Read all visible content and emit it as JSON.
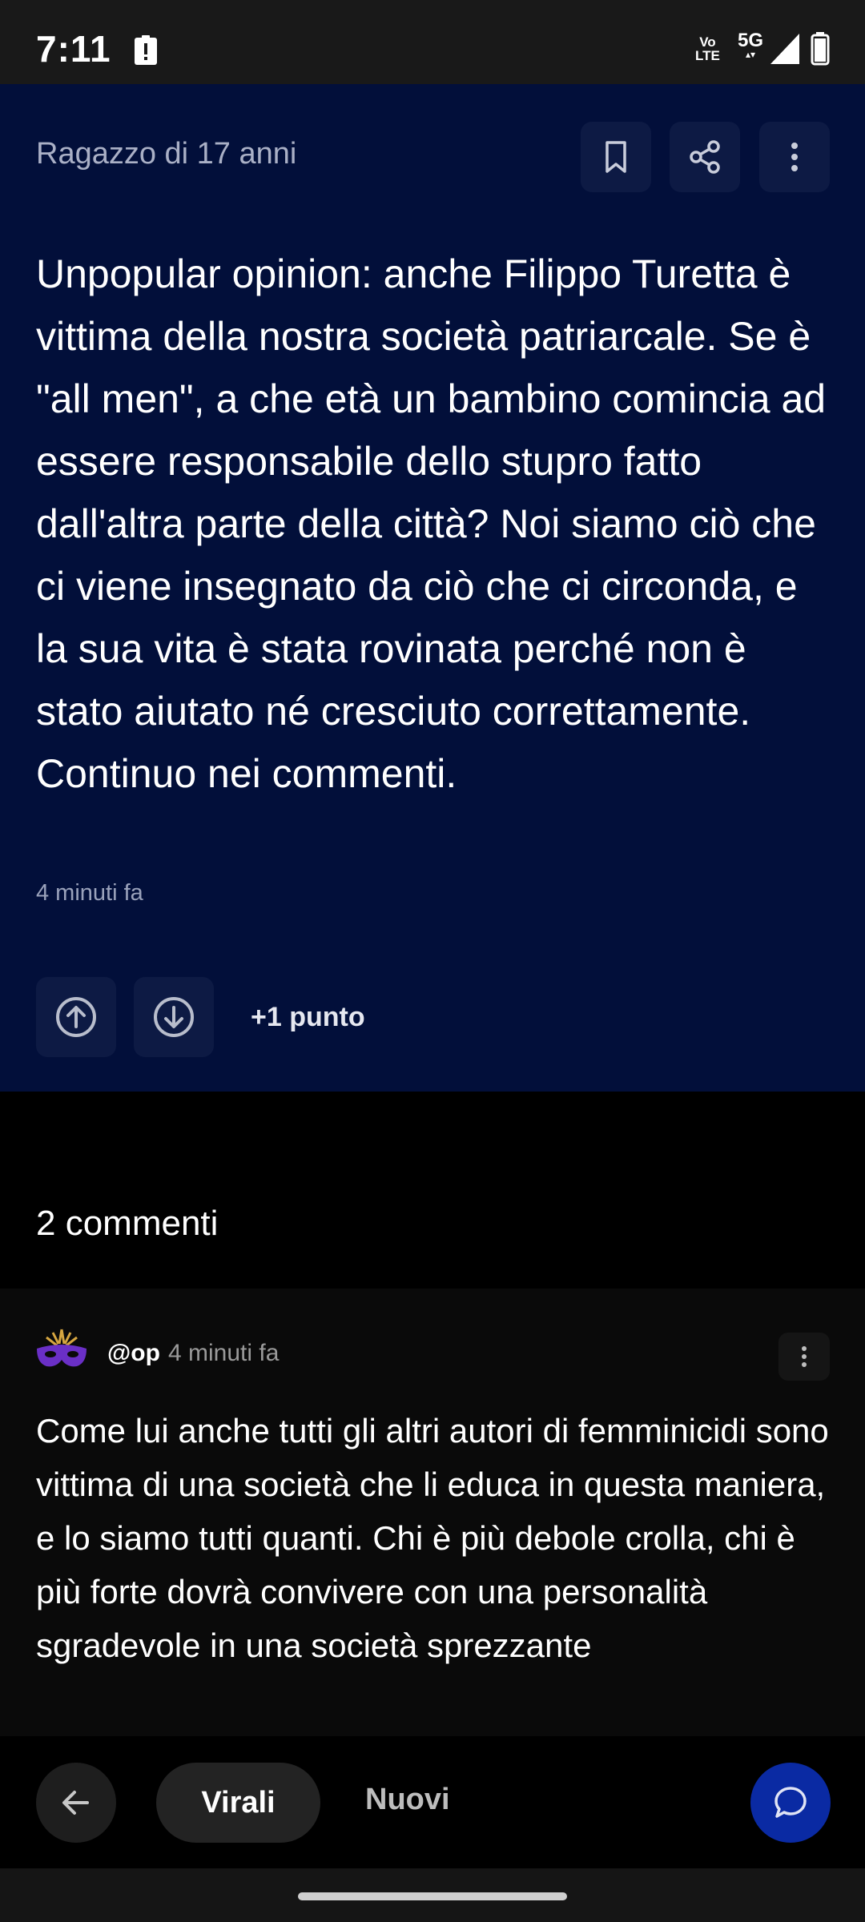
{
  "status_bar": {
    "time": "7:11",
    "volte_label": "Vo LTE",
    "network": "5G",
    "icons": [
      "alert-icon",
      "volte-icon",
      "signal-icon",
      "battery-icon"
    ]
  },
  "post": {
    "author": "Ragazzo di 17 anni",
    "text": "Unpopular opinion: anche Filippo Turetta è vittima della nostra società patriarcale. Se è \"all men\", a che età un bambino comincia ad essere responsabile dello stupro fatto dall'altra parte della città? Noi siamo ciò che ci viene insegnato da ciò che ci circonda, e la sua vita è stata rovinata perché non è stato aiutato né cresciuto correttamente. Continuo nei commenti.",
    "time": "4 minuti fa",
    "score": "+1 punto",
    "actions": [
      "bookmark-icon",
      "share-icon",
      "more-icon"
    ]
  },
  "comments": {
    "title": "2 commenti",
    "items": [
      {
        "user": "@op",
        "time": "4 minuti fa",
        "text": "Come lui anche tutti gli altri autori di femminicidi sono vittima di una società che li educa in questa maniera, e lo siamo tutti quanti. Chi è più debole crolla, chi è più forte dovrà convivere con una personalità sgradevole in una società sprezzante"
      }
    ]
  },
  "bottom_bar": {
    "tabs": [
      "Virali",
      "Nuovi"
    ],
    "selected_tab": "Virali"
  },
  "colors": {
    "post_bg": "#020f3a",
    "accent": "#0a2aa3",
    "avatar_purple": "#6a2fc6"
  }
}
